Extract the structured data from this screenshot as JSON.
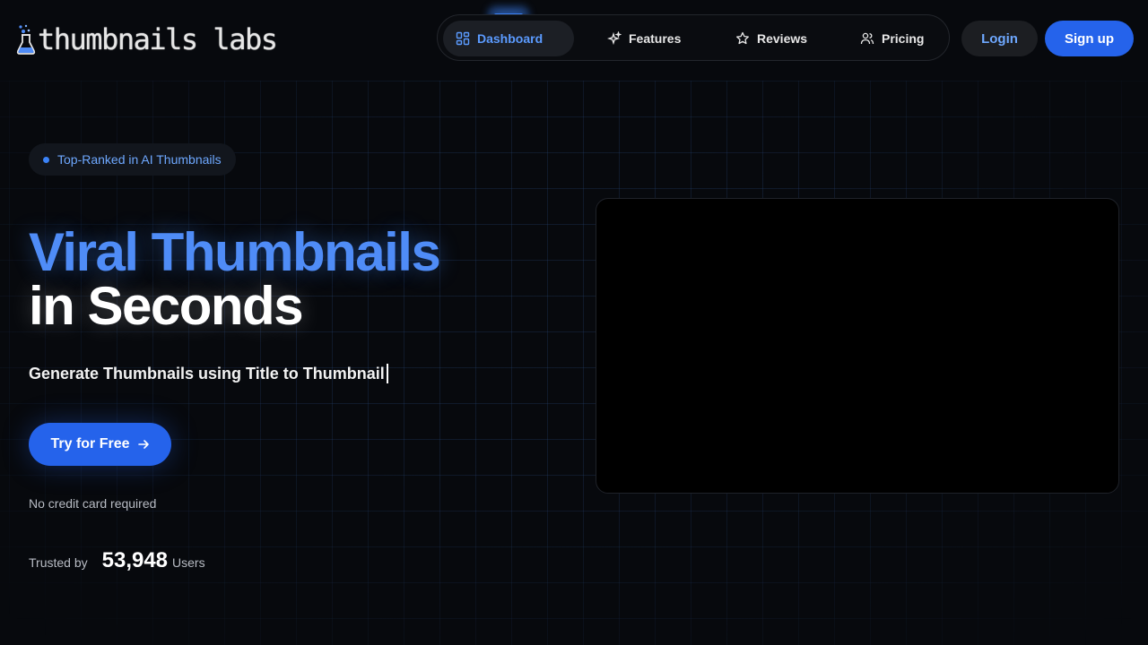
{
  "brand": {
    "name": "thumbnails labs"
  },
  "nav": {
    "items": [
      {
        "label": "Dashboard",
        "icon": "dashboard-grid-icon",
        "active": true
      },
      {
        "label": "Features",
        "icon": "sparkles-icon",
        "active": false
      },
      {
        "label": "Reviews",
        "icon": "star-icon",
        "active": false
      },
      {
        "label": "Pricing",
        "icon": "users-icon",
        "active": false
      }
    ],
    "login_label": "Login",
    "signup_label": "Sign up"
  },
  "hero": {
    "badge": "Top-Ranked in AI Thumbnails",
    "headline_line1": "Viral Thumbnails",
    "headline_line2": "in Seconds",
    "subline": "Generate Thumbnails using Title to Thumbnail",
    "cta_label": "Try for Free",
    "note": "No credit card required",
    "trusted_label": "Trusted by",
    "trusted_count": "53,948",
    "trusted_unit": "Users"
  },
  "colors": {
    "accent": "#2563eb",
    "accent_text": "#4f8cf7",
    "background": "#07090d"
  }
}
